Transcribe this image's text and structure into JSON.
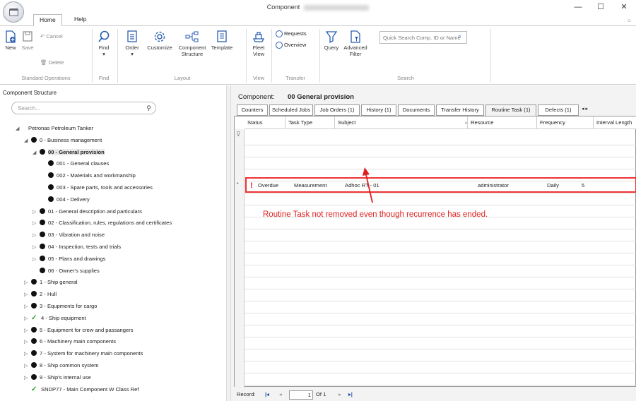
{
  "window": {
    "title": "Component",
    "minimize": "—",
    "maximize": "☐",
    "close": "✕"
  },
  "tabs": [
    {
      "label": "Home"
    },
    {
      "label": "Help"
    }
  ],
  "ribbon": {
    "new": "New",
    "save": "Save",
    "cancel": "Cancel",
    "delete": "Delete",
    "find": "Find",
    "order": "Order",
    "customize": "Customize",
    "component_structure": "Component Structure",
    "template": "Template",
    "fleet_view": "Fleet View",
    "requests": "Requests",
    "overview": "Overview",
    "query": "Query",
    "advanced_filter": "Advanced Filter",
    "quick_search_placeholder": "Quick Search Comp. ID or Name",
    "groups": {
      "standard": "Standard Operations",
      "find": "Find",
      "layout": "Layout",
      "view": "View",
      "transfer": "Transfer",
      "search": "Search"
    }
  },
  "left": {
    "title": "Component Structure",
    "search_placeholder": "Search...",
    "tree": [
      {
        "label": "Petronas Petroleum Tanker",
        "exp": "◢",
        "indent": 0,
        "marker": "none"
      },
      {
        "label": "0 - Business management",
        "exp": "◢",
        "indent": 1,
        "marker": "dot"
      },
      {
        "label": "00 - General provision",
        "exp": "◢",
        "indent": 2,
        "marker": "dot",
        "selected": true
      },
      {
        "label": "001 - General clauses",
        "exp": "",
        "indent": 3,
        "marker": "dot"
      },
      {
        "label": "002 - Materials and workmanship",
        "exp": "",
        "indent": 3,
        "marker": "dot"
      },
      {
        "label": "003 - Spare parts, tools and accessories",
        "exp": "",
        "indent": 3,
        "marker": "dot"
      },
      {
        "label": "004 - Delivery",
        "exp": "",
        "indent": 3,
        "marker": "dot"
      },
      {
        "label": "01 - General description and particulars",
        "exp": "▷",
        "indent": 2,
        "marker": "dot"
      },
      {
        "label": "02 - Classification, rules, regulations and certificates",
        "exp": "▷",
        "indent": 2,
        "marker": "dot"
      },
      {
        "label": "03 - Vibration and noise",
        "exp": "▷",
        "indent": 2,
        "marker": "dot"
      },
      {
        "label": "04 - Inspection, tests and trials",
        "exp": "▷",
        "indent": 2,
        "marker": "dot"
      },
      {
        "label": "05 - Plans and drawings",
        "exp": "▷",
        "indent": 2,
        "marker": "dot"
      },
      {
        "label": "06 - Owner's supplies",
        "exp": "",
        "indent": 2,
        "marker": "dot"
      },
      {
        "label": "1 - Ship general",
        "exp": "▷",
        "indent": 1,
        "marker": "dot"
      },
      {
        "label": "2 - Hull",
        "exp": "▷",
        "indent": 1,
        "marker": "dot"
      },
      {
        "label": "3 - Equpments for cargo",
        "exp": "▷",
        "indent": 1,
        "marker": "dot"
      },
      {
        "label": "4 - Ship equipment",
        "exp": "▷",
        "indent": 1,
        "marker": "check"
      },
      {
        "label": "5 - Equipment for crew and passangers",
        "exp": "▷",
        "indent": 1,
        "marker": "dot"
      },
      {
        "label": "6 - Machinery main components",
        "exp": "▷",
        "indent": 1,
        "marker": "dot"
      },
      {
        "label": "7 - System for machinery main components",
        "exp": "▷",
        "indent": 1,
        "marker": "dot"
      },
      {
        "label": "8 - Ship common system",
        "exp": "▷",
        "indent": 1,
        "marker": "dot"
      },
      {
        "label": "9 - Ship's internal use",
        "exp": "▷",
        "indent": 1,
        "marker": "dot"
      },
      {
        "label": "SNDP77 - Main Component W Class Ref",
        "exp": "",
        "indent": 1,
        "marker": "check"
      }
    ]
  },
  "right": {
    "component_label": "Component:",
    "component_value": "00 General provision",
    "tabs": [
      "Counters",
      "Scheduled Jobs",
      "Job Orders (1)",
      "History (1)",
      "Documents",
      "Transfer History",
      "Routine Task (1)",
      "Defects (1)"
    ],
    "tab_scroll": "◂ ▸",
    "columns": [
      "Status",
      "Task Type",
      "Subject",
      "Resource",
      "Frequency",
      "Interval Length"
    ],
    "row": {
      "flag": "!",
      "status": "Overdue",
      "task_type": "Measurement",
      "subject": "Adhoc RT - 01",
      "resource": "administrator",
      "frequency": "Daily",
      "interval": "5"
    },
    "annotation": "Routine Task not removed even though recurrence has ended.",
    "record": {
      "label": "Record:",
      "current": "1",
      "of": "Of  1"
    }
  },
  "colors": {
    "highlight": "#e33333",
    "annotation": "#e02020",
    "accent": "#2a5db0",
    "check": "#2a9d2a"
  }
}
